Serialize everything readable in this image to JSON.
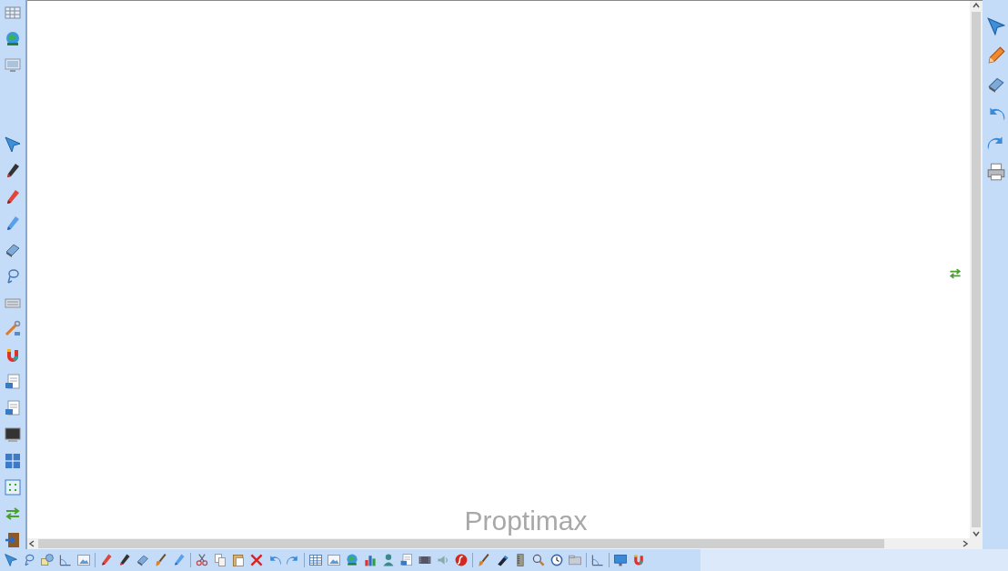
{
  "canvas": {
    "brand_text": "Proptimax"
  }
}
